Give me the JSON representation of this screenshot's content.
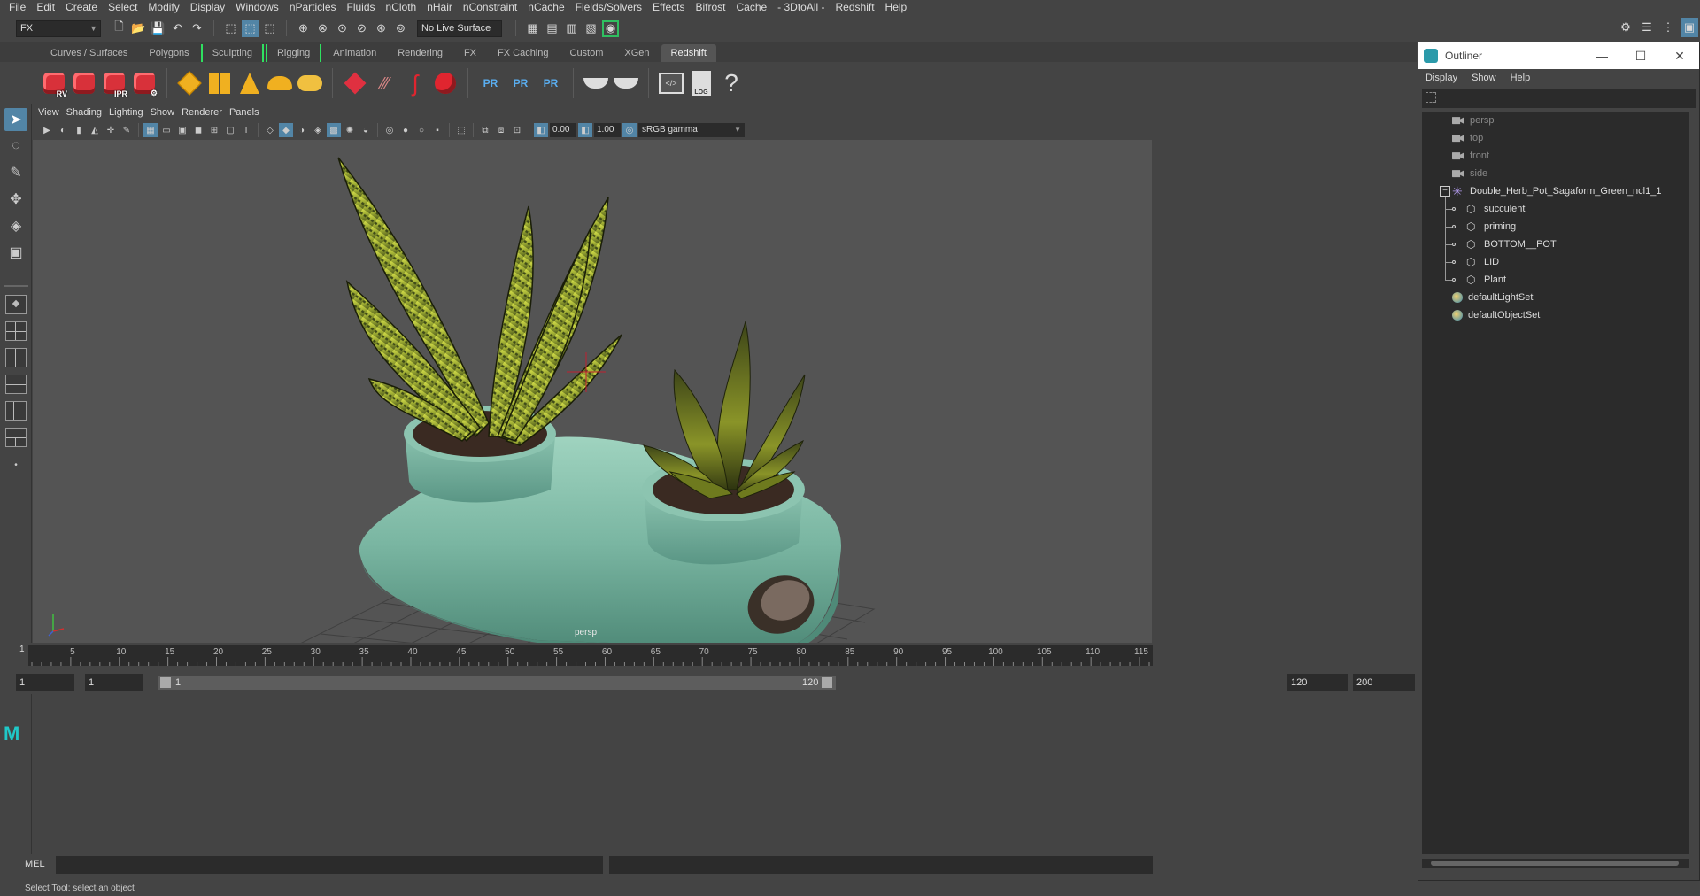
{
  "menubar": [
    "File",
    "Edit",
    "Create",
    "Select",
    "Modify",
    "Display",
    "Windows",
    "nParticles",
    "Fluids",
    "nCloth",
    "nHair",
    "nConstraint",
    "nCache",
    "Fields/Solvers",
    "Effects",
    "Bifrost",
    "Cache",
    "- 3DtoAll -",
    "Redshift",
    "Help"
  ],
  "statusline": {
    "menu_set": "FX",
    "live_surface": "No Live Surface"
  },
  "shelf_tabs": [
    "Curves / Surfaces",
    "Polygons",
    "Sculpting",
    "Rigging",
    "Animation",
    "Rendering",
    "FX",
    "FX Caching",
    "Custom",
    "XGen",
    "Redshift"
  ],
  "shelf_active": "Redshift",
  "shelf_labels": {
    "rv": "RV",
    "ipr": "IPR",
    "pr": "PR",
    "log": "LOG",
    "help": "?"
  },
  "viewport": {
    "menu": [
      "View",
      "Shading",
      "Lighting",
      "Show",
      "Renderer",
      "Panels"
    ],
    "exposure": "0.00",
    "gamma": "1.00",
    "color_space": "sRGB gamma",
    "camera_label": "persp"
  },
  "timeline": {
    "ticks": [
      "5",
      "10",
      "15",
      "20",
      "25",
      "30",
      "35",
      "40",
      "45",
      "50",
      "55",
      "60",
      "65",
      "70",
      "75",
      "80",
      "85",
      "90",
      "95",
      "100",
      "105",
      "110",
      "115"
    ],
    "current_frame": "1",
    "range_start": "1",
    "playback_start": "1",
    "slider_min": "1",
    "slider_max": "120",
    "playback_end": "120",
    "range_end": "200"
  },
  "cmdline": {
    "label": "MEL"
  },
  "helpline": "Select Tool: select an object",
  "outliner": {
    "title": "Outliner",
    "menu": [
      "Display",
      "Show",
      "Help"
    ],
    "items": [
      {
        "label": "persp",
        "type": "camera",
        "dim": true
      },
      {
        "label": "top",
        "type": "camera",
        "dim": true
      },
      {
        "label": "front",
        "type": "camera",
        "dim": true
      },
      {
        "label": "side",
        "type": "camera",
        "dim": true
      },
      {
        "label": "Double_Herb_Pot_Sagaform_Green_ncl1_1",
        "type": "group"
      },
      {
        "label": "succulent",
        "type": "mesh"
      },
      {
        "label": "priming",
        "type": "mesh"
      },
      {
        "label": "BOTTOM__POT",
        "type": "mesh"
      },
      {
        "label": "LID",
        "type": "mesh"
      },
      {
        "label": "Plant",
        "type": "mesh"
      },
      {
        "label": "defaultLightSet",
        "type": "set"
      },
      {
        "label": "defaultObjectSet",
        "type": "set"
      }
    ]
  },
  "colors": {
    "accent": "#5285a6",
    "bg": "#444444",
    "viewport_bg": "#545454",
    "pot": "#7fb8a5",
    "leaf": "#a8b83a"
  }
}
